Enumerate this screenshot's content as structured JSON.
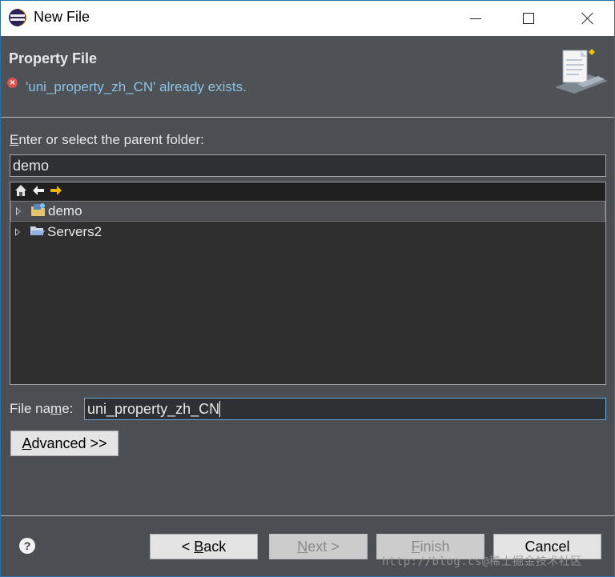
{
  "window": {
    "title": "New File",
    "controls": [
      "minimize",
      "maximize",
      "close"
    ]
  },
  "header": {
    "title": "Property File",
    "error_message": "'uni_property_zh_CN' already exists."
  },
  "parent_folder": {
    "label_prefix": "",
    "label_mnemonic": "E",
    "label_rest": "nter or select the parent folder:",
    "value": "demo"
  },
  "tree": {
    "toolbar_icons": [
      "home-icon",
      "back-arrow-icon",
      "forward-arrow-icon"
    ],
    "items": [
      {
        "label": "demo",
        "icon": "project-icon",
        "selected": true
      },
      {
        "label": "Servers2",
        "icon": "folder-icon",
        "selected": false
      }
    ]
  },
  "file_name": {
    "label_prefix": "File na",
    "label_mnemonic": "m",
    "label_rest": "e:",
    "value": "uni_property_zh_CN"
  },
  "advanced_button": {
    "label_mnemonic": "A",
    "label_rest": "dvanced >>"
  },
  "footer": {
    "help_glyph": "?",
    "back": {
      "prefix": "< ",
      "mnemonic": "B",
      "rest": "ack",
      "enabled": true
    },
    "next": {
      "prefix": "",
      "mnemonic": "N",
      "rest": "ext >",
      "enabled": false
    },
    "finish": {
      "prefix": "",
      "mnemonic": "F",
      "rest": "inish",
      "enabled": false
    },
    "cancel": {
      "label": "Cancel",
      "enabled": true
    },
    "watermark": "http://blog.cs@稀土掘金技术社区"
  }
}
